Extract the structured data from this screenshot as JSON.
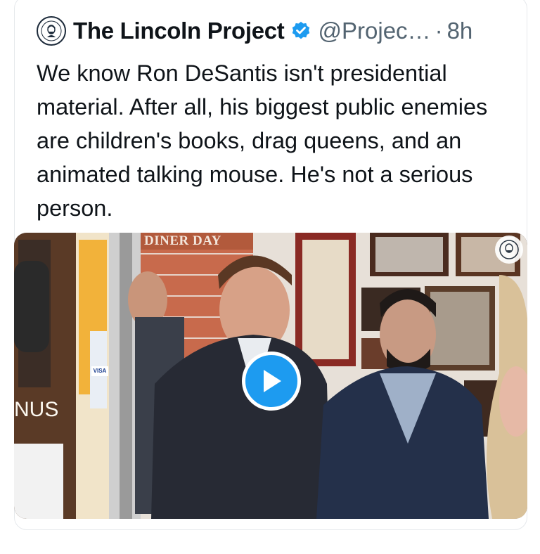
{
  "tweet": {
    "author_name": "The Lincoln Project",
    "handle": "@Projec…",
    "separator": "·",
    "time": "8h",
    "verified": true,
    "text": "We know Ron DeSantis isn't presidential material. After all, his biggest public enemies are children's books, drag queens, and an animated talking mouse. He's not a serious person."
  },
  "media": {
    "type": "video",
    "sign_text": "DINER DAY",
    "door_text": "NUS",
    "card_labels": [
      "VISA"
    ],
    "play_icon": "play-icon"
  },
  "colors": {
    "accent": "#1d9bf0",
    "text": "#0f1419",
    "secondary": "#536471"
  }
}
